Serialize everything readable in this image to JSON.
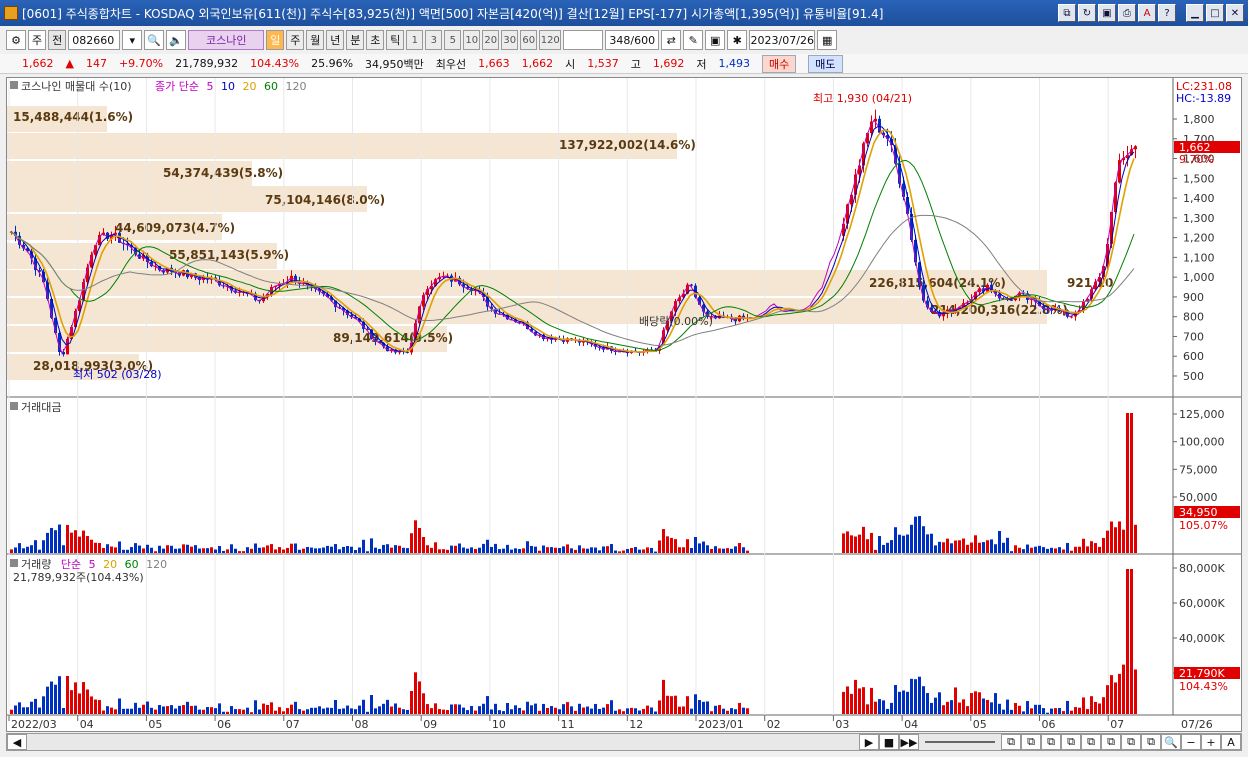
{
  "window": {
    "title": "[0601] 주식종합차트 - KOSDAQ 외국인보유[611(천)] 주식수[83,925(천)] 액면[500] 자본금[420(억)] 결산[12월] EPS[-177] 시가총액[1,395(억)] 유통비율[91.4]"
  },
  "toolbar": {
    "market": "주",
    "prev_label": "전",
    "code": "082660",
    "stock_name": "코스나인",
    "periods": [
      "일",
      "주",
      "월",
      "년",
      "분",
      "초",
      "틱"
    ],
    "active_period": "일",
    "intervals": [
      "1",
      "3",
      "5",
      "10",
      "20",
      "30",
      "60",
      "120"
    ],
    "count": "348",
    "count_total": "/600",
    "date": "2023/07/26"
  },
  "quote": {
    "price": "1,662",
    "change_arrow": "▲",
    "change": "147",
    "change_pct": "+9.70%",
    "volume": "21,789,932",
    "vol_ratio": "104.43%",
    "turnover": "25.96%",
    "amount": "34,950백만",
    "bid_label": "최우선",
    "bid_ask": "1,663",
    "bid": "1,662",
    "open_label": "시",
    "open": "1,537",
    "high_label": "고",
    "high": "1,692",
    "low_label": "저",
    "low": "1,493",
    "buy": "매수",
    "sell": "매도"
  },
  "price_panel": {
    "legend_title": "코스나인 매물대 수(10)",
    "ma_label": "종가 단순",
    "ma_periods": [
      "5",
      "10",
      "20",
      "60",
      "120"
    ],
    "ma_colors": [
      "#c000c0",
      "#0000c0",
      "#e0a000",
      "#008000",
      "#808080"
    ],
    "lc": "LC:231.08",
    "hc": "HC:-13.89",
    "current_price_tag": "1,662",
    "current_pct_tag": "9.70%",
    "high_note": "최고 1,930 (04/21)",
    "low_note": "최저 502 (03/28)",
    "dividend_note": "배당락(0.00%)",
    "y_ticks": [
      "1,800",
      "1,700",
      "1,600",
      "1,500",
      "1,400",
      "1,300",
      "1,200",
      "1,100",
      "1,000",
      "900",
      "800",
      "700",
      "600",
      "500"
    ],
    "volume_profile": [
      {
        "label": "15,488,444(1.6%)"
      },
      {
        "label": "137,922,002(14.6%)"
      },
      {
        "label": "54,374,439(5.8%)"
      },
      {
        "label": "75,104,146(8.0%)"
      },
      {
        "label": "44,609,073(4.7%)"
      },
      {
        "label": "55,851,143(5.9%)"
      },
      {
        "label": "226,815,604(24.1%)"
      },
      {
        "label": "921,10"
      },
      {
        "label": "214,200,316(22.8%)"
      },
      {
        "label": "89,149,614(9.5%)"
      },
      {
        "label": "28,018,993(3.0%)"
      }
    ]
  },
  "amount_panel": {
    "title": "거래대금",
    "y_ticks": [
      "125,000",
      "100,000",
      "75,000",
      "50,000"
    ],
    "current_tag": "34,950",
    "pct_tag": "105.07%"
  },
  "volume_panel": {
    "title": "거래량",
    "ma_label": "단순",
    "ma_periods": [
      "5",
      "20",
      "60",
      "120"
    ],
    "current_text": "21,789,932주(104.43%)",
    "y_ticks": [
      "80,000K",
      "60,000K",
      "40,000K",
      "20,000K"
    ],
    "current_tag": "21,790K",
    "pct_tag": "104.43%"
  },
  "x_axis": {
    "labels": [
      "2022/03",
      "04",
      "05",
      "06",
      "07",
      "08",
      "09",
      "10",
      "11",
      "12",
      "2023/01",
      "02",
      "03",
      "04",
      "05",
      "06",
      "07"
    ],
    "last_label": "07/26"
  },
  "chart_data": {
    "type": "candlestick",
    "title": "코스나인",
    "ylim": [
      450,
      1850
    ],
    "x_labels": [
      "2022/03",
      "04",
      "05",
      "06",
      "07",
      "08",
      "09",
      "10",
      "11",
      "12",
      "2023/01",
      "02",
      "03",
      "04",
      "05",
      "06",
      "07"
    ],
    "close_path": [
      1230,
      1130,
      960,
      580,
      860,
      1180,
      1220,
      1160,
      1090,
      1040,
      1030,
      1000,
      990,
      960,
      920,
      880,
      960,
      1000,
      940,
      900,
      840,
      770,
      680,
      620,
      620,
      950,
      1000,
      980,
      940,
      840,
      800,
      760,
      700,
      690,
      680,
      660,
      640,
      630,
      620,
      630,
      850,
      960,
      790,
      790,
      790,
      790,
      860,
      820,
      840,
      960,
      1200,
      1500,
      1800,
      1700,
      1400,
      900,
      800,
      840,
      900,
      960,
      880,
      910,
      860,
      840,
      800,
      880,
      1050,
      1600,
      1662
    ],
    "annotations": [
      {
        "label": "최고 1,930 (04/21)",
        "value": 1930
      },
      {
        "label": "최저 502 (03/28)",
        "value": 502
      },
      {
        "label": "배당락(0.00%)"
      }
    ]
  }
}
